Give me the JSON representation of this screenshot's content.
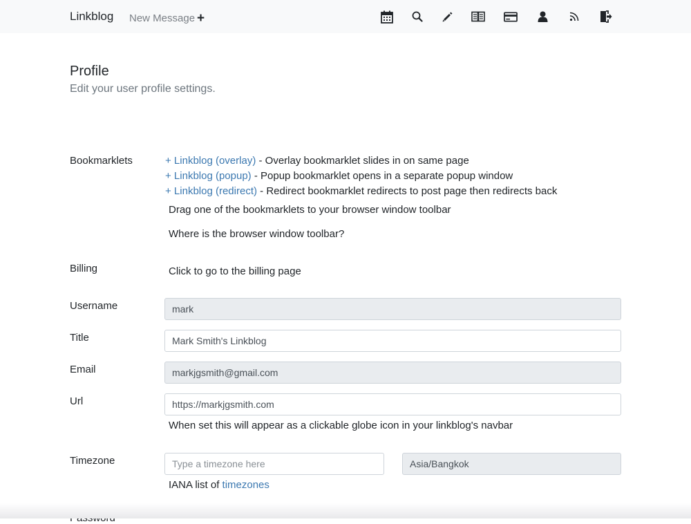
{
  "navbar": {
    "brand": "Linkblog",
    "new_message": "New Message",
    "new_message_icon": "+",
    "icons": [
      "calendar-icon",
      "search-icon",
      "pencil-icon",
      "book-icon",
      "credit-card-icon",
      "user-icon",
      "rss-icon",
      "logout-icon"
    ]
  },
  "header": {
    "title": "Profile",
    "subtitle": "Edit your user profile settings."
  },
  "bookmarklets": {
    "label": "Bookmarklets",
    "items": [
      {
        "link": "+ Linkblog (overlay)",
        "desc": " - Overlay bookmarklet slides in on same page"
      },
      {
        "link": "+ Linkblog (popup)",
        "desc": " - Popup bookmarklet opens in a separate popup window"
      },
      {
        "link": "+ Linkblog (redirect)",
        "desc": " - Redirect bookmarklet redirects to post page then redirects back"
      }
    ],
    "hint": "Drag one of the bookmarklets to your browser window toolbar",
    "help_link": "Where is the browser window toolbar?"
  },
  "billing": {
    "label": "Billing",
    "link": "Click to go to the billing page"
  },
  "form": {
    "username_label": "Username",
    "username_value": "mark",
    "title_label": "Title",
    "title_value": "Mark Smith's Linkblog",
    "email_label": "Email",
    "email_value": "markjgsmith@gmail.com",
    "url_label": "Url",
    "url_value": "https://markjgsmith.com",
    "url_hint": "When set this will appear as a clickable globe icon in your linkblog's navbar",
    "timezone_label": "Timezone",
    "timezone_placeholder": "Type a timezone here",
    "timezone_value": "Asia/Bangkok",
    "timezone_hint_prefix": "IANA list of ",
    "timezone_hint_link": "timezones",
    "password_label": "Password"
  },
  "colors": {
    "link": "#3b78b0",
    "navbar_bg": "#f8f9fa",
    "readonly_bg": "#e9ecef"
  }
}
